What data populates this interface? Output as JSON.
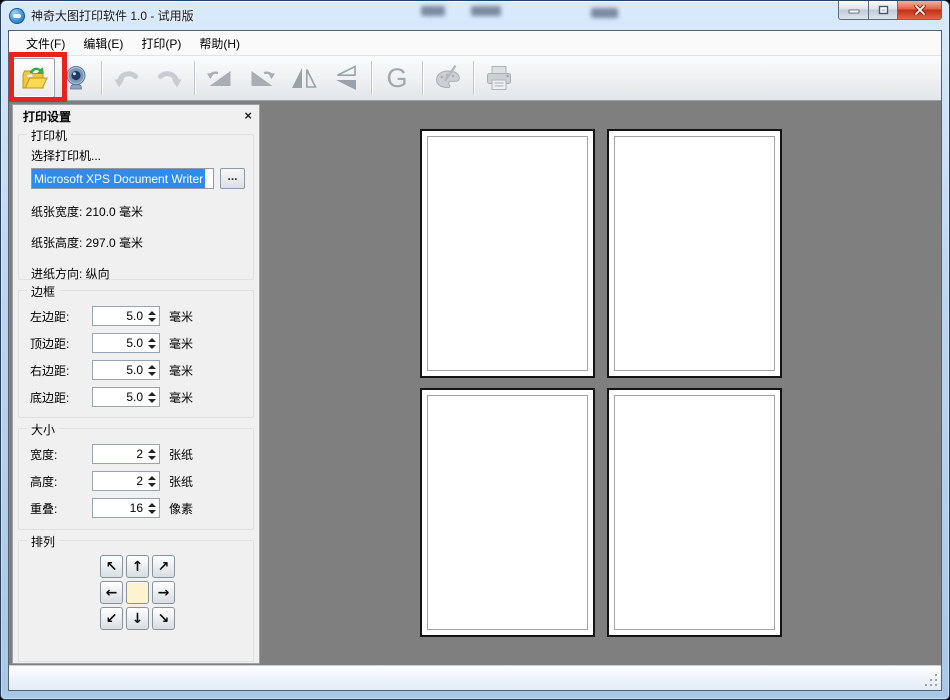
{
  "window": {
    "title": "神奇大图打印软件 1.0 - 试用版"
  },
  "menu": {
    "items": [
      "文件(F)",
      "编辑(E)",
      "打印(P)",
      "帮助(H)"
    ]
  },
  "toolbar": {
    "icons": [
      "open-file",
      "camera-capture",
      "undo",
      "redo",
      "rotate-left",
      "rotate-right",
      "flip-horizontal",
      "flip-vertical",
      "grayscale",
      "palette",
      "print"
    ],
    "grayscale_label": "G",
    "highlight_color": "#e5241e"
  },
  "panel": {
    "title": "打印设置",
    "close_icon": "×",
    "printer": {
      "label": "打印机",
      "select_label": "选择打印机...",
      "name": "Microsoft XPS Document Writer",
      "browse_label": "...",
      "paper_width": "纸张宽度: 210.0 毫米",
      "paper_height": "纸张高度: 297.0 毫米",
      "feed_direction": "进纸方向: 纵向"
    },
    "border": {
      "label": "边框",
      "rows": [
        {
          "label": "左边距:",
          "value": "5.0",
          "unit": "毫米"
        },
        {
          "label": "顶边距:",
          "value": "5.0",
          "unit": "毫米"
        },
        {
          "label": "右边距:",
          "value": "5.0",
          "unit": "毫米"
        },
        {
          "label": "底边距:",
          "value": "5.0",
          "unit": "毫米"
        }
      ]
    },
    "size": {
      "label": "大小",
      "rows": [
        {
          "label": "宽度:",
          "value": "2",
          "unit": "张纸"
        },
        {
          "label": "高度:",
          "value": "2",
          "unit": "张纸"
        },
        {
          "label": "重叠:",
          "value": "16",
          "unit": "像素"
        }
      ]
    },
    "arrange": {
      "label": "排列",
      "arrows": [
        "↖",
        "↑",
        "↗",
        "←",
        "",
        "→",
        "↙",
        "↓",
        "↘"
      ]
    }
  },
  "preview": {
    "rows": 2,
    "cols": 2,
    "canvas_color": "#7f7f7f"
  },
  "colors": {
    "selection": "#2f8cef",
    "close_button": "#c22f12"
  }
}
